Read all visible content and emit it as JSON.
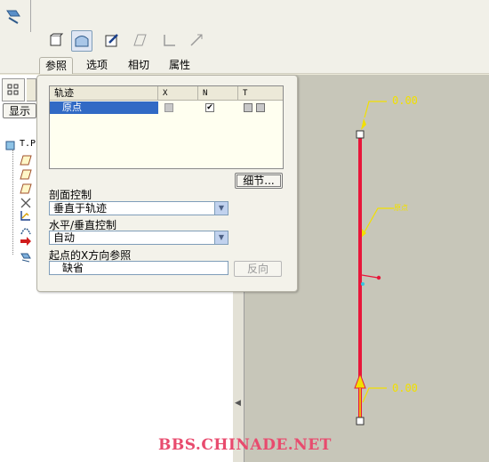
{
  "toolbar": {
    "icons": [
      "solid-icon",
      "surface-icon",
      "sketch-icon",
      "parallelogram-icon",
      "corner-icon",
      "line-icon"
    ]
  },
  "tabs": [
    {
      "label": "参照",
      "active": true
    },
    {
      "label": "选项",
      "active": false
    },
    {
      "label": "相切",
      "active": false
    },
    {
      "label": "属性",
      "active": false
    }
  ],
  "left_panel": {
    "show_button": "显示",
    "tree_root": "T.P"
  },
  "trajectory_table": {
    "headers": [
      "轨迹",
      "X",
      "N",
      "T"
    ],
    "rows": [
      {
        "name": "原点",
        "x_checked": false,
        "n_checked": true
      }
    ]
  },
  "detail_button": "细节...",
  "section_control": {
    "label": "剖面控制",
    "value": "垂直于轨迹"
  },
  "hv_control": {
    "label": "水平/垂直控制",
    "value": "自动"
  },
  "x_direction_ref": {
    "label": "起点的X方向参照",
    "value": "缺省",
    "flip_button": "反向"
  },
  "viewport": {
    "top_dim": "0.00",
    "bottom_dim": "0.00",
    "origin_label": "原点"
  },
  "watermark": "BBS.CHINADE.NET",
  "colors": {
    "trajectory": "#e8163a",
    "annotation": "#f2e000",
    "selection": "#316ac5"
  }
}
